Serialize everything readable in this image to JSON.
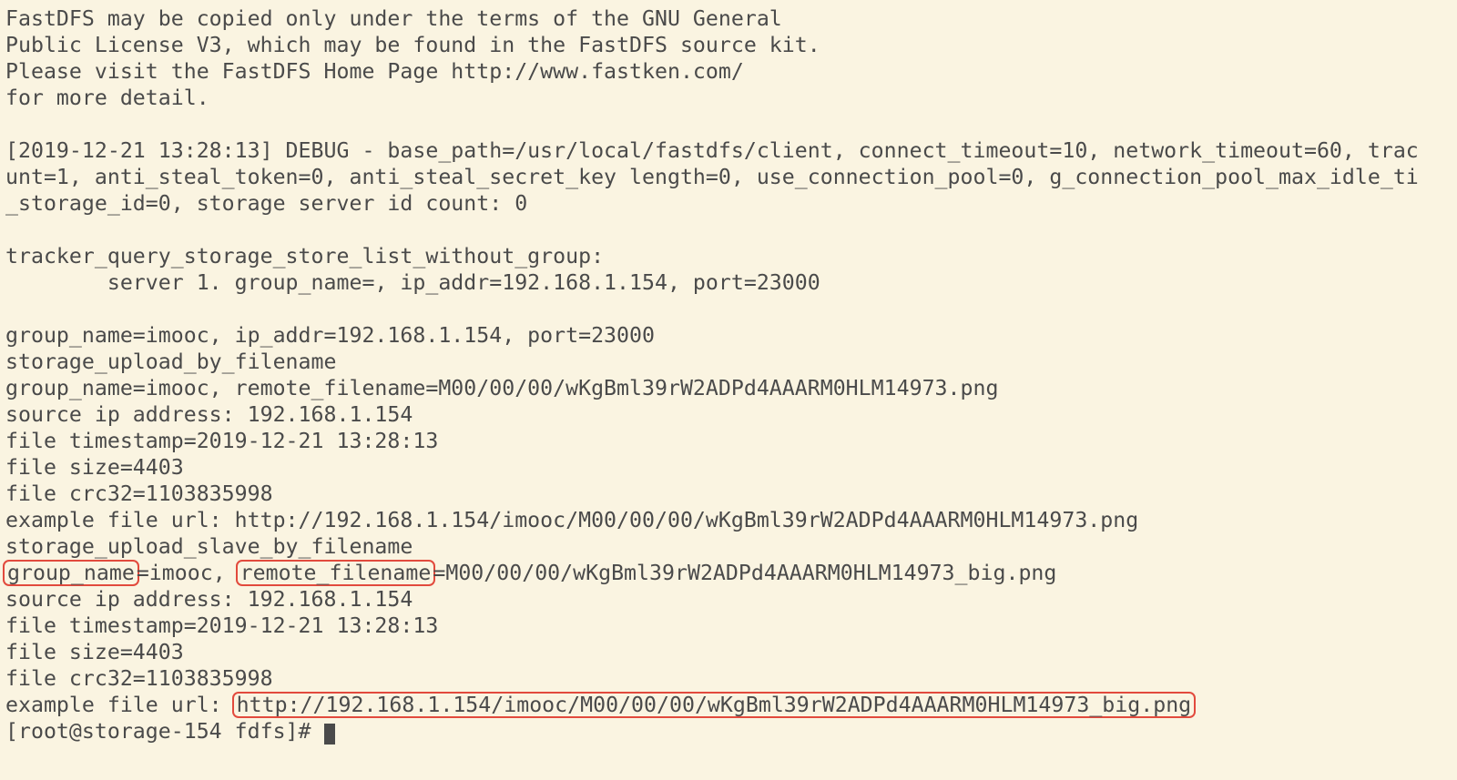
{
  "lines": {
    "l1": "FastDFS may be copied only under the terms of the GNU General",
    "l2": "Public License V3, which may be found in the FastDFS source kit.",
    "l3": "Please visit the FastDFS Home Page http://www.fastken.com/",
    "l4": "for more detail.",
    "l5": "",
    "l6": "[2019-12-21 13:28:13] DEBUG - base_path=/usr/local/fastdfs/client, connect_timeout=10, network_timeout=60, trac",
    "l7": "unt=1, anti_steal_token=0, anti_steal_secret_key length=0, use_connection_pool=0, g_connection_pool_max_idle_ti",
    "l8": "_storage_id=0, storage server id count: 0",
    "l9": "",
    "l10": "tracker_query_storage_store_list_without_group:",
    "l11": "        server 1. group_name=, ip_addr=192.168.1.154, port=23000",
    "l12": "",
    "l13": "group_name=imooc, ip_addr=192.168.1.154, port=23000",
    "l14": "storage_upload_by_filename",
    "l15": "group_name=imooc, remote_filename=M00/00/00/wKgBml39rW2ADPd4AAARM0HLM14973.png",
    "l16": "source ip address: 192.168.1.154",
    "l17": "file timestamp=2019-12-21 13:28:13",
    "l18": "file size=4403",
    "l19": "file crc32=1103835998",
    "l20": "example file url: http://192.168.1.154/imooc/M00/00/00/wKgBml39rW2ADPd4AAARM0HLM14973.png",
    "l21": "storage_upload_slave_by_filename",
    "l22a": "group_name",
    "l22b": "=imooc, ",
    "l22c": "remote_filename",
    "l22d": "=M00/00/00/wKgBml39rW2ADPd4AAARM0HLM14973_big.png",
    "l23": "source ip address: 192.168.1.154",
    "l24": "file timestamp=2019-12-21 13:28:13",
    "l25": "file size=4403",
    "l26": "file crc32=1103835998",
    "l27a": "example file url: ",
    "l27b": "http://192.168.1.154/imooc/M00/00/00/wKgBml39rW2ADPd4AAARM0HLM14973_big.png",
    "prompt": "[root@storage-154 fdfs]# "
  }
}
